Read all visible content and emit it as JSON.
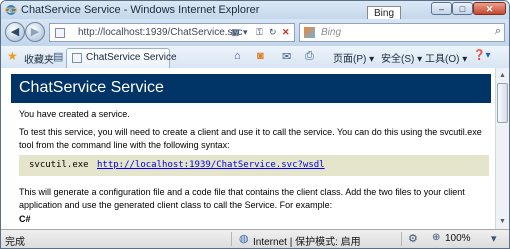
{
  "window": {
    "title": "ChatService Service - Windows Internet Explorer",
    "tooltip": "Bing",
    "minimize": "–",
    "maximize": "□",
    "close": "✕"
  },
  "address_bar": {
    "url": "http://localhost:1939/ChatService.svc",
    "search_placeholder": "Bing"
  },
  "tab_bar": {
    "favorites_label": "收藏夹",
    "tab_title": "ChatService Service",
    "page_menu": "页面(P) ▾",
    "safety_menu": "安全(S) ▾",
    "tools_menu": "工具(O) ▾",
    "help_menu": "❓▾"
  },
  "content": {
    "heading": "ChatService Service",
    "p1": "You have created a service.",
    "p2_line1": "To test this service, you will need to create a client and use it to call the service. You can do this using the svcutil.exe",
    "p2_line2": "tool from the command line with the following syntax:",
    "code_command": "svcutil.exe",
    "code_link": "http://localhost:1939/ChatService.svc?wsdl",
    "p3_line1": "This will generate a configuration file and a code file that contains the client class. Add the two files to your client",
    "p3_line2": "application and use the generated client class to call the Service. For example:",
    "code_label": "C#"
  },
  "status_bar": {
    "status": "完成",
    "zone": "Internet | 保护模式: 启用",
    "zoom": "100%"
  }
}
